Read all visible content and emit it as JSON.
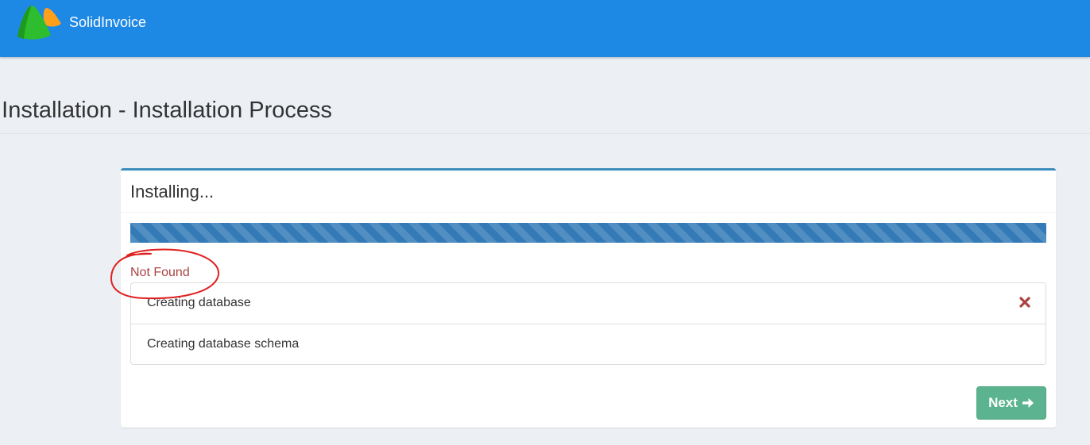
{
  "app": {
    "brand": "SolidInvoice",
    "logo_icon": "solidinvoice-logo-icon"
  },
  "page": {
    "title": "e Installation - Installation Process"
  },
  "install_box": {
    "title": "Installing...",
    "progress_percent": 100,
    "error_message": "Not Found",
    "steps": [
      {
        "label": "Creating database",
        "status": "failed",
        "status_icon": "times-icon"
      },
      {
        "label": "Creating database schema",
        "status": "pending",
        "status_icon": ""
      }
    ],
    "next_label": "Next",
    "next_icon": "arrow-right-icon"
  },
  "annotation": {
    "shape": "hand-drawn-circle",
    "color": "#e02020"
  },
  "colors": {
    "topbar": "#1e88e5",
    "box_accent": "#3c8dbc",
    "progress_bar": "#337ab7",
    "error_text": "#a94442",
    "error_icon": "#a94442",
    "next_button": "#5cb38f"
  }
}
